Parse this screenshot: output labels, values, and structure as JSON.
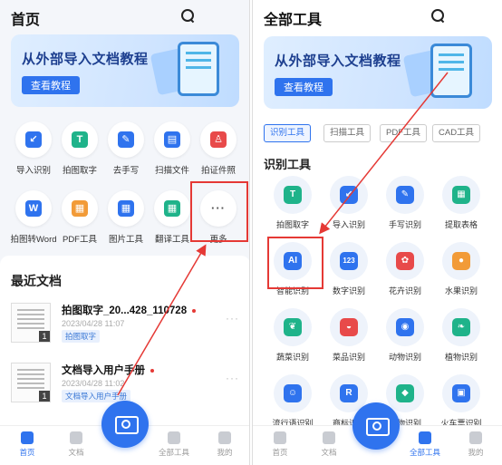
{
  "left": {
    "title": "首页",
    "banner": {
      "text": "从外部导入文档教程",
      "button": "查看教程"
    },
    "tools": [
      {
        "label": "导入识别",
        "color": "#2f73ee",
        "glyph": "↙"
      },
      {
        "label": "拍图取字",
        "color": "#1fb38a",
        "glyph": "T"
      },
      {
        "label": "去手写",
        "color": "#2f73ee",
        "glyph": "✎"
      },
      {
        "label": "扫描文件",
        "color": "#2f73ee",
        "glyph": "▤"
      },
      {
        "label": "拍证件照",
        "color": "#e84a4a",
        "glyph": "♙"
      },
      {
        "label": "拍图转Word",
        "color": "#2f73ee",
        "glyph": "W"
      },
      {
        "label": "PDF工具",
        "color": "#f29b38",
        "glyph": "▦"
      },
      {
        "label": "图片工具",
        "color": "#2f73ee",
        "glyph": "▦"
      },
      {
        "label": "翻译工具",
        "color": "#1fb38a",
        "glyph": "▦"
      },
      {
        "label": "更多",
        "color": "#666666",
        "glyph": "···"
      }
    ],
    "recent_title": "最近文档",
    "docs": [
      {
        "name": "拍图取字_20...428_110728",
        "date": "2023/04/28 11:07",
        "tag": "拍图取字",
        "count": "1"
      },
      {
        "name": "文档导入用户手册",
        "date": "2023/04/28 11:02",
        "tag": "文档导入用户手册",
        "count": "1"
      }
    ],
    "tabs": [
      "首页",
      "文档",
      "全部工具",
      "我的"
    ]
  },
  "right": {
    "title": "全部工具",
    "banner": {
      "text": "从外部导入文档教程",
      "button": "查看教程"
    },
    "filters": [
      "识别工具",
      "扫描工具",
      "PDF工具",
      "CAD工具"
    ],
    "section_title": "识别工具",
    "tools": [
      {
        "label": "拍图取字",
        "color": "#1fb38a",
        "glyph": "T"
      },
      {
        "label": "导入识别",
        "color": "#2f73ee",
        "glyph": "↙"
      },
      {
        "label": "手写识别",
        "color": "#2f73ee",
        "glyph": "✎"
      },
      {
        "label": "提取表格",
        "color": "#1fb38a",
        "glyph": "▦"
      },
      {
        "label": "智能识别",
        "color": "#2f73ee",
        "glyph": "AI"
      },
      {
        "label": "数字识别",
        "color": "#2f73ee",
        "glyph": "123"
      },
      {
        "label": "花卉识别",
        "color": "#e84a4a",
        "glyph": "✿"
      },
      {
        "label": "水果识别",
        "color": "#f29b38",
        "glyph": "●"
      },
      {
        "label": "蔬菜识别",
        "color": "#1fb38a",
        "glyph": "❦"
      },
      {
        "label": "菜品识别",
        "color": "#e84a4a",
        "glyph": "◒"
      },
      {
        "label": "动物识别",
        "color": "#2f73ee",
        "glyph": "◉"
      },
      {
        "label": "植物识别",
        "color": "#1fb38a",
        "glyph": "❧"
      },
      {
        "label": "流行语识别",
        "color": "#2f73ee",
        "glyph": "☺"
      },
      {
        "label": "商标识别",
        "color": "#2f73ee",
        "glyph": "R"
      },
      {
        "label": "动物识别",
        "color": "#1fb38a",
        "glyph": "◆"
      },
      {
        "label": "火车票识别",
        "color": "#2f73ee",
        "glyph": "▣"
      }
    ],
    "tabs": [
      "首页",
      "文档",
      "全部工具",
      "我的"
    ]
  }
}
